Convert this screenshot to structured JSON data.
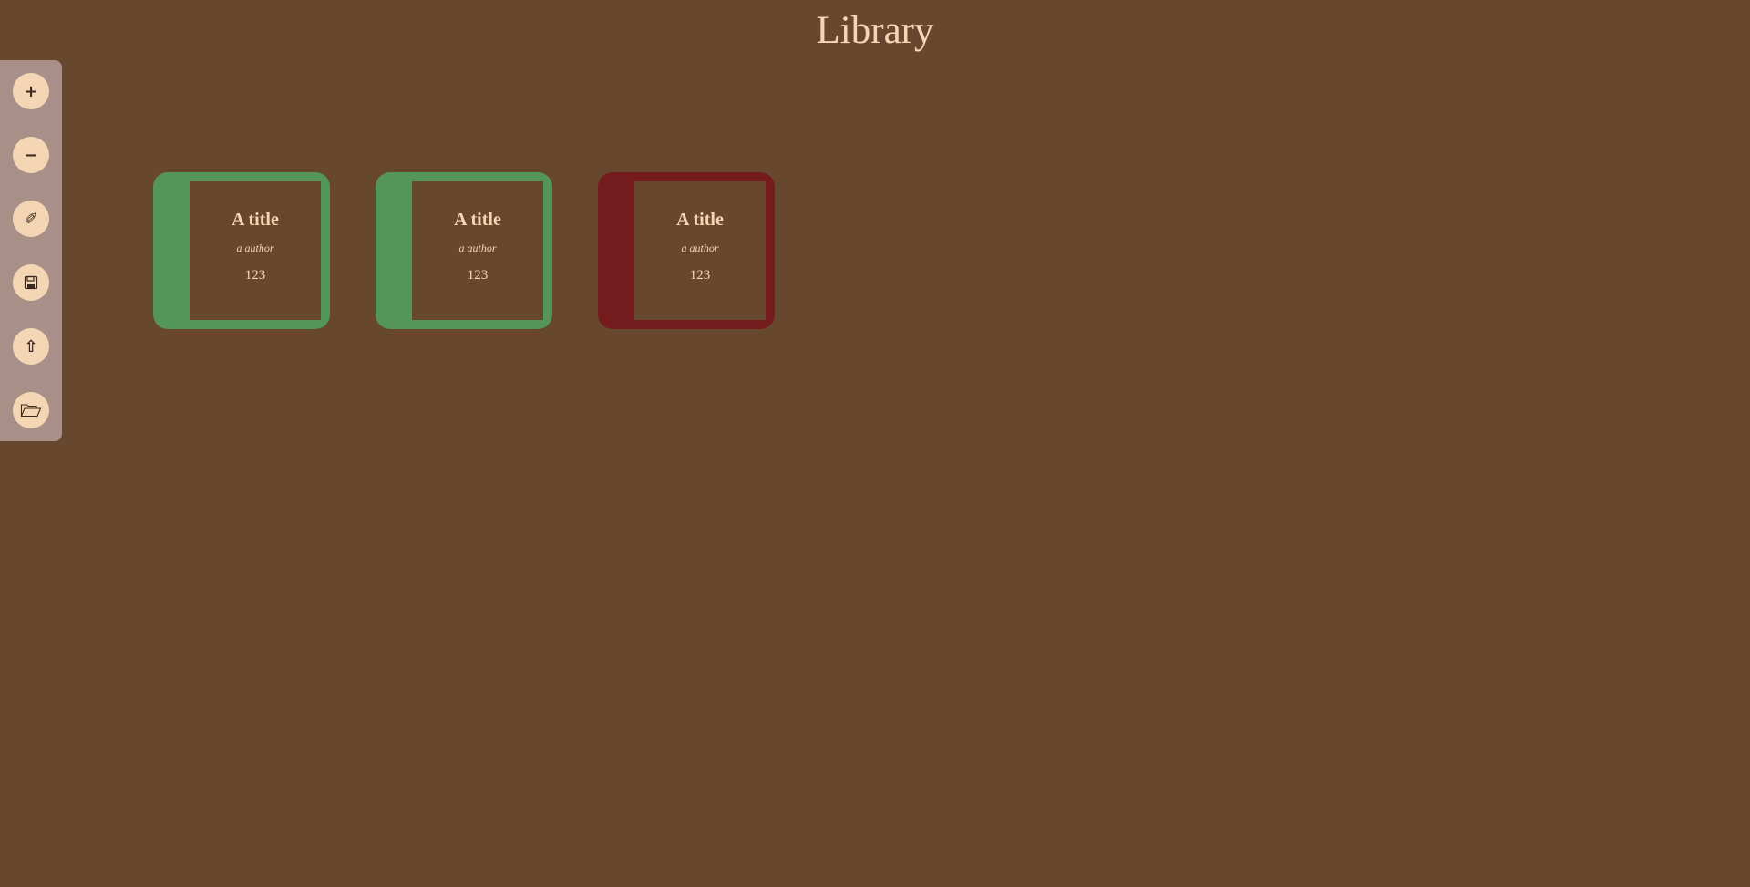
{
  "header": {
    "title": "Library"
  },
  "colors": {
    "background": "#68472f",
    "text": "#f5d6b4",
    "toolbar": "#a89088",
    "read": "#54955a",
    "unread": "#741b1e"
  },
  "toolbar": {
    "buttons": [
      {
        "name": "add-book-button",
        "icon": "plus-icon",
        "glyph": "+"
      },
      {
        "name": "remove-book-button",
        "icon": "minus-icon",
        "glyph": "−"
      },
      {
        "name": "edit-book-button",
        "icon": "pencil-icon",
        "glyph": "✐"
      },
      {
        "name": "save-button",
        "icon": "floppy-disk-icon",
        "glyph": ""
      },
      {
        "name": "upload-button",
        "icon": "upload-arrow-icon",
        "glyph": "⇧"
      },
      {
        "name": "open-folder-button",
        "icon": "folder-open-icon",
        "glyph": ""
      }
    ]
  },
  "books": [
    {
      "title": "A title",
      "author": "a author",
      "pages": "123",
      "status": "read"
    },
    {
      "title": "A title",
      "author": "a author",
      "pages": "123",
      "status": "read"
    },
    {
      "title": "A title",
      "author": "a author",
      "pages": "123",
      "status": "unread"
    }
  ]
}
